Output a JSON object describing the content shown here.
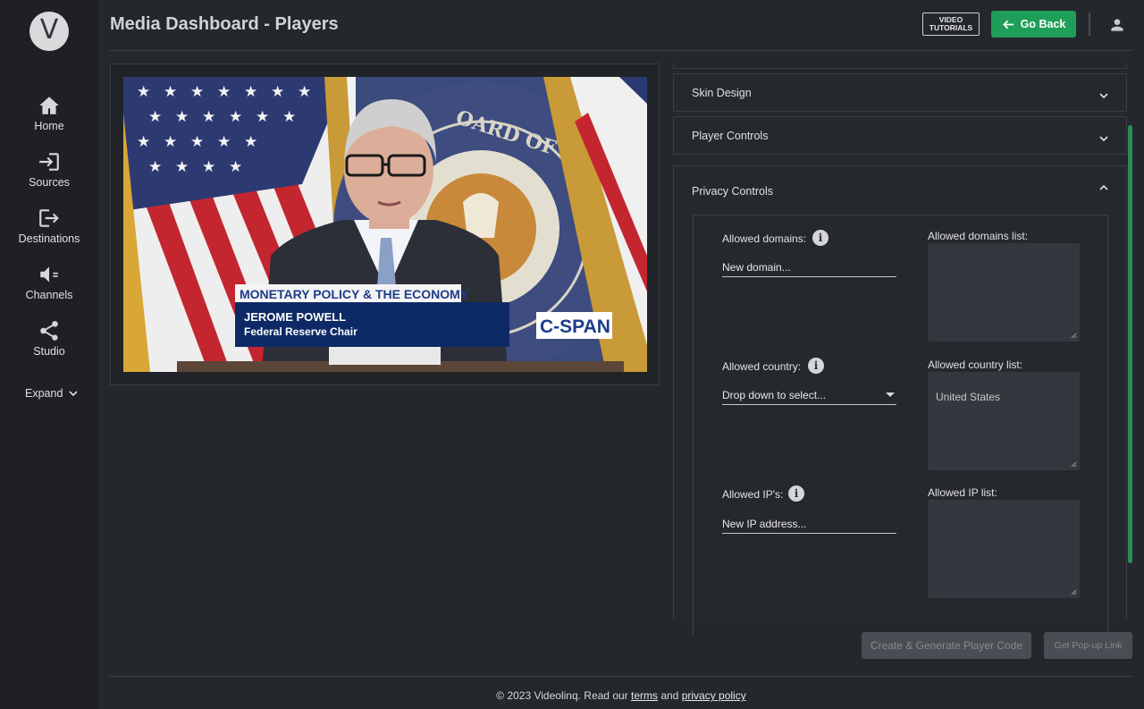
{
  "app": {
    "logo_letter": "V"
  },
  "header": {
    "title": "Media Dashboard - Players",
    "video_tutorials_line1": "VIDEO",
    "video_tutorials_line2": "TUTORIALS",
    "go_back_label": "Go Back"
  },
  "sidebar": {
    "items": [
      {
        "label": "Home",
        "icon": "home-icon"
      },
      {
        "label": "Sources",
        "icon": "sign-in-icon"
      },
      {
        "label": "Destinations",
        "icon": "sign-out-icon"
      },
      {
        "label": "Channels",
        "icon": "speaker-icon"
      },
      {
        "label": "Studio",
        "icon": "share-icon"
      }
    ],
    "expand_label": "Expand"
  },
  "video": {
    "lower_third_topic": "MONETARY POLICY & THE ECONOMY",
    "lower_third_name": "JEROME POWELL",
    "lower_third_title": "Federal Reserve Chair",
    "network_bug": "C-SPAN",
    "seal_text": "OARD OF GOVERNO"
  },
  "accordion": {
    "skin_design": "Skin Design",
    "player_controls": "Player Controls",
    "privacy_controls": "Privacy Controls"
  },
  "privacy": {
    "allowed_domains_label": "Allowed domains:",
    "allowed_domains_placeholder": "New domain...",
    "allowed_domains_list_label": "Allowed domains list:",
    "allowed_domains_list": "",
    "allowed_country_label": "Allowed country:",
    "allowed_country_select": "Drop down to select...",
    "allowed_country_list_label": "Allowed country list:",
    "allowed_country_list": "United States",
    "allowed_ips_label": "Allowed IP's:",
    "allowed_ips_placeholder": "New IP address...",
    "allowed_ip_list_label": "Allowed IP list:",
    "allowed_ip_list": ""
  },
  "actions": {
    "create_generate": "Create & Generate Player Code",
    "get_popup": "Get Pop-up Link"
  },
  "footer": {
    "prefix": "© 2023 Videolinq. Read our ",
    "terms": "terms",
    "and": " and ",
    "privacy": "privacy policy"
  },
  "colors": {
    "background": "#24272c",
    "sidebar": "#1e2024",
    "accent_green": "#1e9e58",
    "disabled_button": "#4a4d53"
  }
}
